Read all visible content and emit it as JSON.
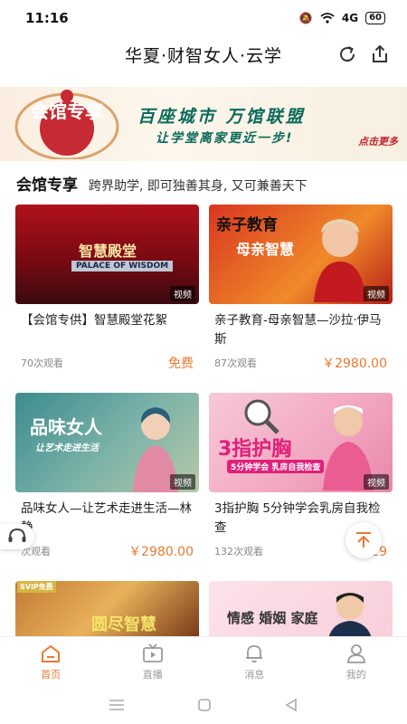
{
  "status_bar": {
    "time": "11:16",
    "battery": "60",
    "signal": "4G"
  },
  "header": {
    "title": "华夏·财智女人·云学"
  },
  "banner": {
    "badge": "会馆专享",
    "slogan_line1": "百座城市 万馆联盟",
    "slogan_line2": "让学堂离家更近一步!",
    "more": "点击更多"
  },
  "section": {
    "title": "会馆专享",
    "subtitle": "跨界助学, 即可独善其身, 又可兼善天下"
  },
  "cards": [
    {
      "title": "【会馆专供】智慧殿堂花絮",
      "views": "70次观看",
      "price": "免费",
      "tag": "视频",
      "thumb_text": "智慧殿堂",
      "thumb_sub": "PALACE OF WISDOM"
    },
    {
      "title": "亲子教育-母亲智慧—沙拉·伊马斯",
      "views": "87次观看",
      "price": "￥2980.00",
      "tag": "视频",
      "thumb_text": "亲子教育",
      "thumb_sub": "母亲智慧"
    },
    {
      "title": "品味女人—让艺术走进生活—林静",
      "views": "次观看",
      "price": "￥2980.00",
      "tag": "视频",
      "thumb_text": "品味女人",
      "thumb_sub": "让艺术走进生活"
    },
    {
      "title": "3指护胸 5分钟学会乳房自我检查",
      "views": "132次观看",
      "price": "￥29",
      "tag": "视频",
      "thumb_text": "3指护胸",
      "thumb_sub": "5分钟学会 乳房自我检查"
    },
    {
      "thumb_text": "圆尽智慧",
      "thumb_sub": "SVIP免费"
    },
    {
      "thumb_text": "情感 婚姻 家庭",
      "thumb_sub": ""
    }
  ],
  "tabs": [
    {
      "label": "首页",
      "icon": "home-icon",
      "active": true
    },
    {
      "label": "直播",
      "icon": "live-tv-icon",
      "active": false
    },
    {
      "label": "消息",
      "icon": "bell-icon",
      "active": false
    },
    {
      "label": "我的",
      "icon": "user-icon",
      "active": false
    }
  ],
  "colors": {
    "accent": "#e67a32",
    "banner_green": "#0a6a5a",
    "banner_red": "#c0262e"
  }
}
